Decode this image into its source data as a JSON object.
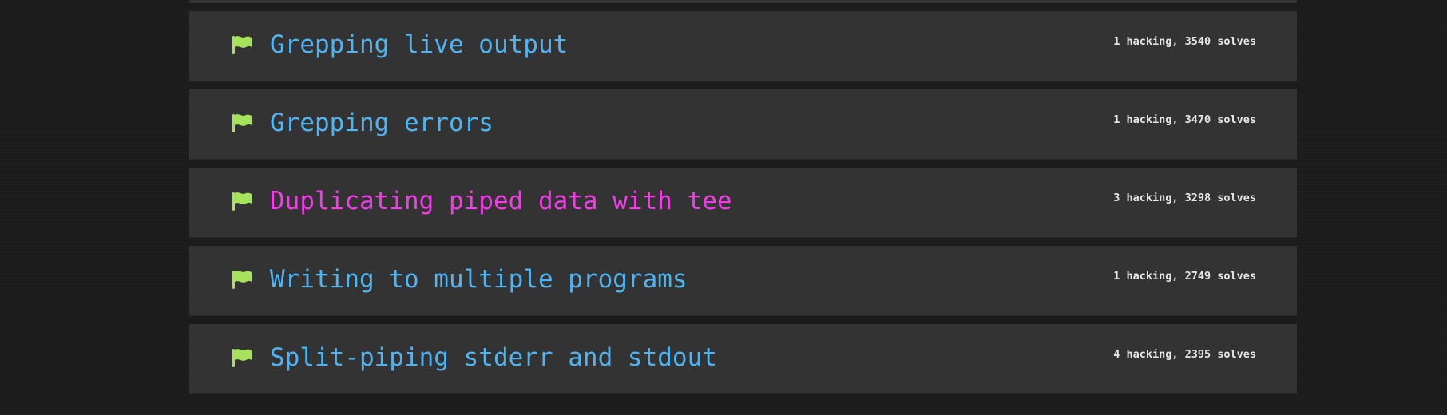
{
  "colors": {
    "background": "#1c1c1c",
    "row_background": "#333333",
    "title_default": "#4fb4f2",
    "title_highlight": "#f23ce8",
    "flag": "#a6e35a",
    "stats_text": "#e6e6e6"
  },
  "challenges": [
    {
      "icon": "flag-icon",
      "title": "Grepping live output",
      "stats": "1 hacking, 3540 solves",
      "highlighted": false
    },
    {
      "icon": "flag-icon",
      "title": "Grepping errors",
      "stats": "1 hacking, 3470 solves",
      "highlighted": false
    },
    {
      "icon": "flag-icon",
      "title": "Duplicating piped data with tee",
      "stats": "3 hacking, 3298 solves",
      "highlighted": true
    },
    {
      "icon": "flag-icon",
      "title": "Writing to multiple programs",
      "stats": "1 hacking, 2749 solves",
      "highlighted": false
    },
    {
      "icon": "flag-icon",
      "title": "Split-piping stderr and stdout",
      "stats": "4 hacking, 2395 solves",
      "highlighted": false
    }
  ]
}
